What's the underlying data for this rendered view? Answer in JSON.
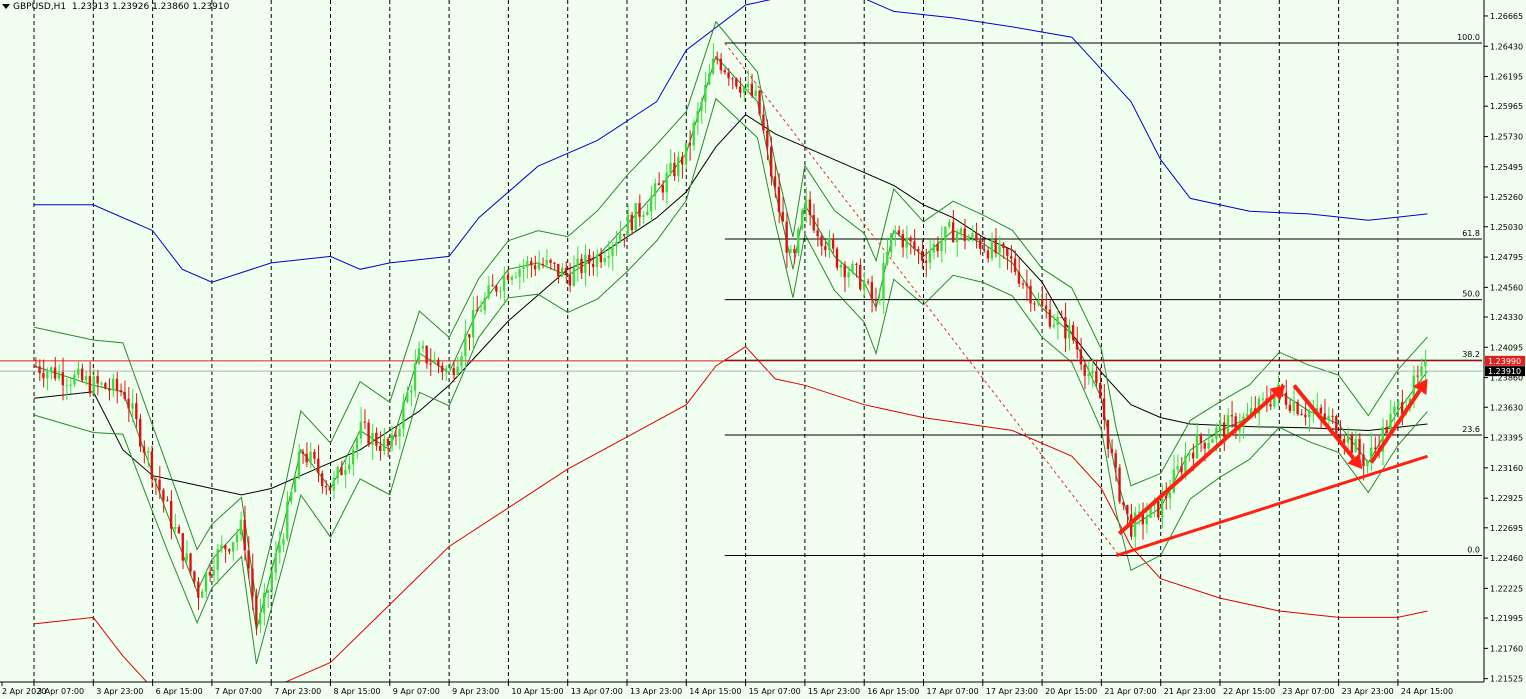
{
  "header": {
    "symbol": "GBPUSD,H1",
    "quote": "1.23913 1.23926 1.23860 1.23910"
  },
  "colors": {
    "background": "#f0fff0",
    "bull_candle": "#3cdc3c",
    "bear_candle": "#e01010",
    "grid": "#000000",
    "fib": "#000000",
    "resistance_line": "#e02020",
    "current_price_line": "#b0b0b0",
    "arrows": "#ff2010",
    "ma_outer_upper": "#0000cc",
    "ma_outer_lower": "#e00000",
    "ma_mid": "#000000",
    "bollinger": "#2a8a2a"
  },
  "chart_data": {
    "type": "candlestick",
    "symbol": "GBPUSD",
    "timeframe": "H1",
    "ylim": [
      1.2153,
      1.2675
    ],
    "y_ticks": [
      "1.26665",
      "1.26430",
      "1.26195",
      "1.25965",
      "1.25730",
      "1.25495",
      "1.25260",
      "1.25030",
      "1.24795",
      "1.24560",
      "1.24330",
      "1.24095",
      "1.23860",
      "1.23630",
      "1.23395",
      "1.23160",
      "1.22925",
      "1.22695",
      "1.22460",
      "1.22225",
      "1.21995",
      "1.21760",
      "1.21525"
    ],
    "x_ticks": [
      "2 Apr 2020",
      "3 Apr 07:00",
      "3 Apr 23:00",
      "6 Apr 15:00",
      "7 Apr 07:00",
      "7 Apr 23:00",
      "8 Apr 15:00",
      "9 Apr 07:00",
      "9 Apr 23:00",
      "10 Apr 15:00",
      "13 Apr 07:00",
      "13 Apr 23:00",
      "14 Apr 15:00",
      "15 Apr 07:00",
      "15 Apr 23:00",
      "16 Apr 15:00",
      "17 Apr 07:00",
      "17 Apr 23:00",
      "20 Apr 15:00",
      "21 Apr 07:00",
      "21 Apr 23:00",
      "22 Apr 15:00",
      "23 Apr 07:00",
      "23 Apr 23:00",
      "24 Apr 15:00"
    ],
    "price_path": [
      [
        0,
        1.2395
      ],
      [
        2,
        1.238
      ],
      [
        3,
        1.2375
      ],
      [
        4.5,
        1.228
      ],
      [
        5.5,
        1.222
      ],
      [
        6,
        1.2245
      ],
      [
        7,
        1.227
      ],
      [
        7.5,
        1.219
      ],
      [
        8.5,
        1.228
      ],
      [
        9,
        1.233
      ],
      [
        10,
        1.23
      ],
      [
        11,
        1.2345
      ],
      [
        12,
        1.233
      ],
      [
        13,
        1.2405
      ],
      [
        14,
        1.239
      ],
      [
        15,
        1.244
      ],
      [
        16,
        1.247
      ],
      [
        17,
        1.2475
      ],
      [
        18,
        1.2465
      ],
      [
        19,
        1.248
      ],
      [
        20,
        1.2505
      ],
      [
        21,
        1.253
      ],
      [
        22,
        1.256
      ],
      [
        23,
        1.2635
      ],
      [
        24.4,
        1.26
      ],
      [
        25,
        1.253
      ],
      [
        25.6,
        1.247
      ],
      [
        26,
        1.252
      ],
      [
        27,
        1.248
      ],
      [
        28,
        1.246
      ],
      [
        28.4,
        1.244
      ],
      [
        29,
        1.25
      ],
      [
        30,
        1.248
      ],
      [
        31,
        1.25
      ],
      [
        32,
        1.249
      ],
      [
        33,
        1.2475
      ],
      [
        34,
        1.244
      ],
      [
        35,
        1.242
      ],
      [
        36,
        1.237
      ],
      [
        36.5,
        1.231
      ],
      [
        37,
        1.227
      ],
      [
        38,
        1.2285
      ],
      [
        39,
        1.233
      ],
      [
        40,
        1.2345
      ],
      [
        41,
        1.2355
      ],
      [
        42,
        1.2375
      ],
      [
        43,
        1.236
      ],
      [
        44,
        1.235
      ],
      [
        45,
        1.232
      ],
      [
        46,
        1.236
      ],
      [
        47,
        1.2391
      ]
    ],
    "fibonacci": {
      "levels": [
        {
          "label": "100.0",
          "price": 1.26455
        },
        {
          "label": "61.8",
          "price": 1.24935
        },
        {
          "label": "50.0",
          "price": 1.24465
        },
        {
          "label": "38.2",
          "price": 1.23995
        },
        {
          "label": "23.6",
          "price": 1.23415
        },
        {
          "label": "0.0",
          "price": 1.2248
        }
      ]
    },
    "price_tags": [
      {
        "label": "1.23990",
        "price": 1.2399,
        "style": "red"
      },
      {
        "label": "1.23910",
        "price": 1.2391,
        "style": "black"
      }
    ],
    "moving_averages": {
      "outer_upper": [
        [
          0,
          1.252
        ],
        [
          2,
          1.252
        ],
        [
          4,
          1.25
        ],
        [
          5,
          1.247
        ],
        [
          6,
          1.246
        ],
        [
          8,
          1.2475
        ],
        [
          10,
          1.248
        ],
        [
          11,
          1.247
        ],
        [
          12,
          1.2475
        ],
        [
          14,
          1.248
        ],
        [
          15,
          1.251
        ],
        [
          17,
          1.255
        ],
        [
          19,
          1.257
        ],
        [
          21,
          1.26
        ],
        [
          22,
          1.264
        ],
        [
          24,
          1.2675
        ],
        [
          27,
          1.269
        ],
        [
          29,
          1.267
        ],
        [
          31,
          1.2665
        ],
        [
          33,
          1.2658
        ],
        [
          35,
          1.265
        ],
        [
          37,
          1.26
        ],
        [
          38,
          1.2555
        ],
        [
          39,
          1.2525
        ],
        [
          41,
          1.2515
        ],
        [
          43,
          1.2513
        ],
        [
          45,
          1.2508
        ],
        [
          47,
          1.2513
        ]
      ],
      "outer_lower": [
        [
          0,
          1.2195
        ],
        [
          2,
          1.22
        ],
        [
          3,
          1.217
        ],
        [
          4,
          1.2145
        ],
        [
          5,
          1.214
        ],
        [
          8,
          1.2145
        ],
        [
          10,
          1.2165
        ],
        [
          12,
          1.221
        ],
        [
          14,
          1.2255
        ],
        [
          16,
          1.2285
        ],
        [
          18,
          1.2315
        ],
        [
          20,
          1.234
        ],
        [
          22,
          1.2365
        ],
        [
          23,
          1.2395
        ],
        [
          24,
          1.241
        ],
        [
          25,
          1.2385
        ],
        [
          26,
          1.238
        ],
        [
          28,
          1.2365
        ],
        [
          30,
          1.2355
        ],
        [
          33,
          1.2345
        ],
        [
          35,
          1.2325
        ],
        [
          36,
          1.23
        ],
        [
          37,
          1.2255
        ],
        [
          38,
          1.223
        ],
        [
          40,
          1.2215
        ],
        [
          42,
          1.2205
        ],
        [
          44,
          1.22
        ],
        [
          46,
          1.22
        ],
        [
          47,
          1.2205
        ]
      ],
      "mid": [
        [
          0,
          1.237
        ],
        [
          2,
          1.2375
        ],
        [
          3,
          1.233
        ],
        [
          4,
          1.231
        ],
        [
          5,
          1.2305
        ],
        [
          6,
          1.23
        ],
        [
          7,
          1.2295
        ],
        [
          8,
          1.23
        ],
        [
          9,
          1.231
        ],
        [
          10,
          1.232
        ],
        [
          11,
          1.233
        ],
        [
          12,
          1.2345
        ],
        [
          13,
          1.236
        ],
        [
          14,
          1.238
        ],
        [
          15,
          1.2405
        ],
        [
          16,
          1.243
        ],
        [
          17,
          1.245
        ],
        [
          18,
          1.247
        ],
        [
          19,
          1.248
        ],
        [
          20,
          1.2495
        ],
        [
          21,
          1.251
        ],
        [
          22,
          1.253
        ],
        [
          23,
          1.2565
        ],
        [
          24,
          1.259
        ],
        [
          25,
          1.2575
        ],
        [
          26,
          1.2565
        ],
        [
          27,
          1.2555
        ],
        [
          28,
          1.2545
        ],
        [
          29,
          1.2535
        ],
        [
          30,
          1.252
        ],
        [
          31,
          1.251
        ],
        [
          32,
          1.2495
        ],
        [
          33,
          1.2485
        ],
        [
          34,
          1.246
        ],
        [
          35,
          1.242
        ],
        [
          36,
          1.239
        ],
        [
          37,
          1.2365
        ],
        [
          38,
          1.2355
        ],
        [
          39,
          1.235
        ],
        [
          41,
          1.2348
        ],
        [
          43,
          1.2347
        ],
        [
          45,
          1.2345
        ],
        [
          47,
          1.235
        ]
      ]
    },
    "trendline_support": [
      [
        36.5,
        1.2248
      ],
      [
        47,
        1.2325
      ]
    ],
    "arrows": [
      [
        [
          36.6,
          1.2265
        ],
        [
          42.2,
          1.238
        ]
      ],
      [
        [
          42.5,
          1.238
        ],
        [
          44.8,
          1.2315
        ]
      ],
      [
        [
          45.1,
          1.232
        ],
        [
          47,
          1.2385
        ]
      ]
    ],
    "grid": "vertical-dashed"
  }
}
